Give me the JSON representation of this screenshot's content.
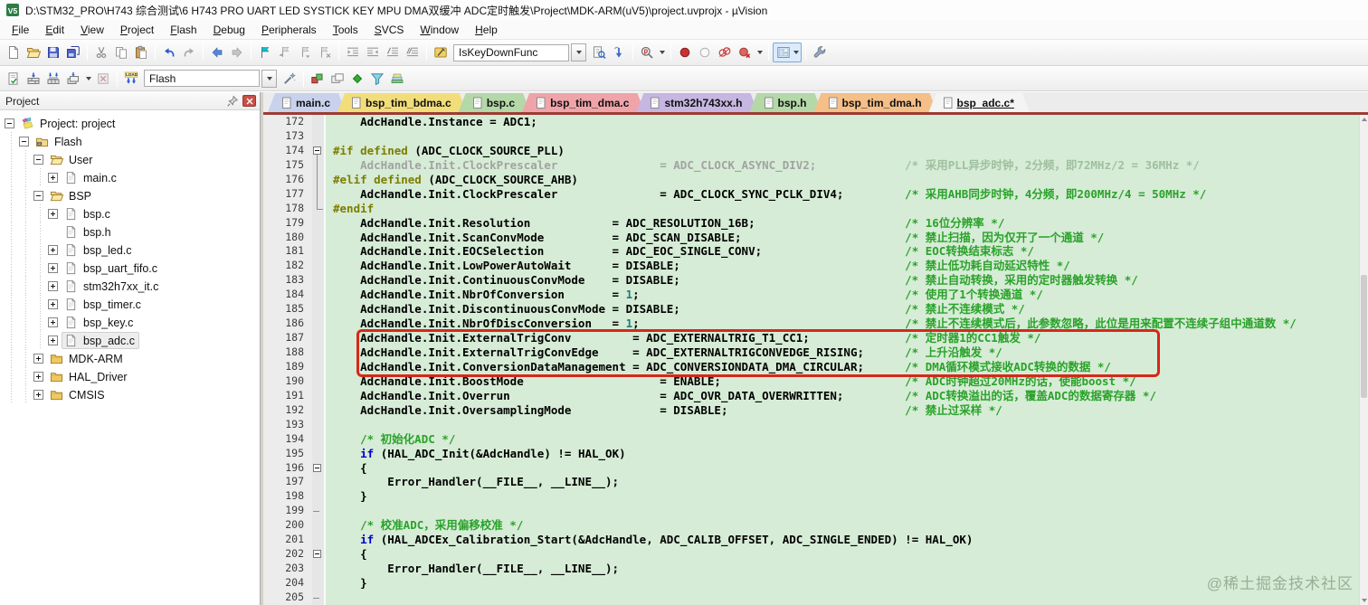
{
  "window": {
    "title": "D:\\STM32_PRO\\H743 综合测试\\6 H743 PRO UART LED SYSTICK KEY MPU DMA双缓冲 ADC定时触发\\Project\\MDK-ARM(uV5)\\project.uvprojx - µVision",
    "app_icon": "uvision-logo-icon"
  },
  "menu": [
    "File",
    "Edit",
    "View",
    "Project",
    "Flash",
    "Debug",
    "Peripherals",
    "Tools",
    "SVCS",
    "Window",
    "Help"
  ],
  "toolbar_main": {
    "function_combo": {
      "value": "IsKeyDownFunc"
    },
    "items": [
      {
        "icon": "new-file"
      },
      {
        "icon": "open-folder"
      },
      {
        "icon": "save"
      },
      {
        "icon": "save-all"
      },
      {
        "sep": true
      },
      {
        "icon": "cut"
      },
      {
        "icon": "copy"
      },
      {
        "icon": "paste"
      },
      {
        "sep": true
      },
      {
        "icon": "undo"
      },
      {
        "icon": "redo"
      },
      {
        "sep": true
      },
      {
        "icon": "nav-back"
      },
      {
        "icon": "nav-forward"
      },
      {
        "sep": true
      },
      {
        "icon": "bookmark-toggle"
      },
      {
        "icon": "bookmark-prev"
      },
      {
        "icon": "bookmark-next"
      },
      {
        "icon": "bookmark-clear"
      },
      {
        "sep": true
      },
      {
        "icon": "indent"
      },
      {
        "icon": "unindent"
      },
      {
        "icon": "comment"
      },
      {
        "icon": "uncomment"
      },
      {
        "sep": true
      },
      {
        "icon": "functions"
      },
      {
        "combo": "toolbar_main.function_combo.value",
        "name": "function-select"
      },
      {
        "icon": "find-in-files"
      },
      {
        "icon": "goto-definition"
      },
      {
        "sep": true
      },
      {
        "icon": "search"
      },
      {
        "caret": true
      },
      {
        "sep": true
      },
      {
        "icon": "breakpoint"
      },
      {
        "icon": "breakpoint-enable"
      },
      {
        "icon": "breakpoint-disable-all"
      },
      {
        "icon": "breakpoint-kill-all"
      },
      {
        "caret": true
      },
      {
        "sep": true
      },
      {
        "icon": "window-layout",
        "state": "active",
        "caret_in": true
      },
      {
        "sep": true
      },
      {
        "icon": "configure"
      }
    ]
  },
  "toolbar_build": {
    "target_combo": {
      "value": "Flash"
    },
    "items": [
      {
        "icon": "translate"
      },
      {
        "icon": "build"
      },
      {
        "icon": "rebuild"
      },
      {
        "icon": "batch-build"
      },
      {
        "caret": true
      },
      {
        "icon": "stop-build"
      },
      {
        "sep": true
      },
      {
        "icon": "load"
      },
      {
        "combo": "toolbar_build.target_combo.value",
        "name": "target-select"
      },
      {
        "icon": "options-wand"
      },
      {
        "sep": true
      },
      {
        "icon": "manage-components"
      },
      {
        "icon": "window-stack"
      },
      {
        "icon": "project-diamond"
      },
      {
        "icon": "filter-funnel"
      },
      {
        "icon": "books-stack"
      }
    ]
  },
  "project_panel": {
    "title": "Project",
    "tree": [
      {
        "label": "Project: project",
        "level": 0,
        "expander": "minus",
        "icon": "project"
      },
      {
        "label": "Flash",
        "level": 1,
        "expander": "minus",
        "icon": "target-folder"
      },
      {
        "label": "User",
        "level": 2,
        "expander": "minus",
        "icon": "folder-open"
      },
      {
        "label": "main.c",
        "level": 3,
        "expander": "plus",
        "icon": "file"
      },
      {
        "label": "BSP",
        "level": 2,
        "expander": "minus",
        "icon": "folder-open"
      },
      {
        "label": "bsp.c",
        "level": 3,
        "expander": "plus",
        "icon": "file"
      },
      {
        "label": "bsp.h",
        "level": 3,
        "expander": "none",
        "icon": "file"
      },
      {
        "label": "bsp_led.c",
        "level": 3,
        "expander": "plus",
        "icon": "file"
      },
      {
        "label": "bsp_uart_fifo.c",
        "level": 3,
        "expander": "plus",
        "icon": "file"
      },
      {
        "label": "stm32h7xx_it.c",
        "level": 3,
        "expander": "plus",
        "icon": "file"
      },
      {
        "label": "bsp_timer.c",
        "level": 3,
        "expander": "plus",
        "icon": "file"
      },
      {
        "label": "bsp_key.c",
        "level": 3,
        "expander": "plus",
        "icon": "file"
      },
      {
        "label": "bsp_adc.c",
        "level": 3,
        "expander": "plus",
        "icon": "file",
        "selected": true
      },
      {
        "label": "MDK-ARM",
        "level": 2,
        "expander": "plus",
        "icon": "folder-closed"
      },
      {
        "label": "HAL_Driver",
        "level": 2,
        "expander": "plus",
        "icon": "folder-closed"
      },
      {
        "label": "CMSIS",
        "level": 2,
        "expander": "plus",
        "icon": "folder-closed"
      }
    ]
  },
  "tabs": [
    {
      "label": "main.c",
      "color": "#c8d2ec"
    },
    {
      "label": "bsp_tim_bdma.c",
      "color": "#f2dd7b"
    },
    {
      "label": "bsp.c",
      "color": "#b4d8a8"
    },
    {
      "label": "bsp_tim_dma.c",
      "color": "#efa4a9"
    },
    {
      "label": "stm32h743xx.h",
      "color": "#c6b6e2"
    },
    {
      "label": "bsp.h",
      "color": "#b4d8a8"
    },
    {
      "label": "bsp_tim_dma.h",
      "color": "#f4bf88"
    },
    {
      "label": "bsp_adc.c*",
      "color": "#f4f4f4",
      "active": true
    }
  ],
  "editor": {
    "first_line": 172,
    "annotation": {
      "from_line": 187,
      "to_line": 189
    },
    "lines": [
      {
        "n": 172,
        "f": "",
        "s": [
          [
            "t",
            "    AdcHandle.Instance = ADC1;"
          ]
        ]
      },
      {
        "n": 173,
        "f": "",
        "s": []
      },
      {
        "n": 174,
        "f": "boxline",
        "s": [
          [
            "p",
            "#if defined "
          ],
          [
            "t",
            "(ADC_CLOCK_SOURCE_PLL)"
          ]
        ]
      },
      {
        "n": 175,
        "f": "line",
        "s": [
          [
            "g",
            "    AdcHandle.Init.ClockPrescaler               = ADC_CLOCK_ASYNC_DIV2;"
          ],
          [
            "gc",
            "             /* 采用PLL异步时钟，2分频，即72MHz/2 = 36MHz */"
          ]
        ]
      },
      {
        "n": 176,
        "f": "line",
        "s": [
          [
            "p",
            "#elif defined "
          ],
          [
            "t",
            "(ADC_CLOCK_SOURCE_AHB)"
          ]
        ]
      },
      {
        "n": 177,
        "f": "line",
        "s": [
          [
            "t",
            "    AdcHandle.Init.ClockPrescaler               = ADC_CLOCK_SYNC_PCLK_DIV4;"
          ],
          [
            "c",
            "         /* 采用AHB同步时钟，4分频，即200MHz/4 = 50MHz */"
          ]
        ]
      },
      {
        "n": 178,
        "f": "end",
        "s": [
          [
            "p",
            "#endif"
          ]
        ]
      },
      {
        "n": 179,
        "f": "",
        "s": [
          [
            "t",
            "    AdcHandle.Init.Resolution            = ADC_RESOLUTION_16B;"
          ],
          [
            "c",
            "                      /* 16位分辨率 */"
          ]
        ]
      },
      {
        "n": 180,
        "f": "",
        "s": [
          [
            "t",
            "    AdcHandle.Init.ScanConvMode          = ADC_SCAN_DISABLE;"
          ],
          [
            "c",
            "                        /* 禁止扫描，因为仅开了一个通道 */"
          ]
        ]
      },
      {
        "n": 181,
        "f": "",
        "s": [
          [
            "t",
            "    AdcHandle.Init.EOCSelection          = ADC_EOC_SINGLE_CONV;"
          ],
          [
            "c",
            "                     /* EOC转换结束标志 */"
          ]
        ]
      },
      {
        "n": 182,
        "f": "",
        "s": [
          [
            "t",
            "    AdcHandle.Init.LowPowerAutoWait      = DISABLE;"
          ],
          [
            "c",
            "                                 /* 禁止低功耗自动延迟特性 */"
          ]
        ]
      },
      {
        "n": 183,
        "f": "",
        "s": [
          [
            "t",
            "    AdcHandle.Init.ContinuousConvMode    = DISABLE;"
          ],
          [
            "c",
            "                                 /* 禁止自动转换，采用的定时器触发转换 */"
          ]
        ]
      },
      {
        "n": 184,
        "f": "",
        "s": [
          [
            "t",
            "    AdcHandle.Init.NbrOfConversion       = "
          ],
          [
            "n",
            "1"
          ],
          [
            "t",
            ";"
          ],
          [
            "c",
            "                                       /* 使用了1个转换通道 */"
          ]
        ]
      },
      {
        "n": 185,
        "f": "",
        "s": [
          [
            "t",
            "    AdcHandle.Init.DiscontinuousConvMode = DISABLE;"
          ],
          [
            "c",
            "                                 /* 禁止不连续模式 */"
          ]
        ]
      },
      {
        "n": 186,
        "f": "",
        "s": [
          [
            "t",
            "    AdcHandle.Init.NbrOfDiscConversion   = "
          ],
          [
            "n",
            "1"
          ],
          [
            "t",
            ";"
          ],
          [
            "c",
            "                                       /* 禁止不连续模式后，此参数忽略，此位是用来配置不连续子组中通道数 */"
          ]
        ]
      },
      {
        "n": 187,
        "f": "",
        "s": [
          [
            "t",
            "    AdcHandle.Init.ExternalTrigConv         = ADC_EXTERNALTRIG_T1_CC1;"
          ],
          [
            "c",
            "              /* 定时器1的CC1触发 */"
          ]
        ]
      },
      {
        "n": 188,
        "f": "",
        "s": [
          [
            "t",
            "    AdcHandle.Init.ExternalTrigConvEdge     = ADC_EXTERNALTRIGCONVEDGE_RISING;"
          ],
          [
            "c",
            "      /* 上升沿触发 */"
          ]
        ]
      },
      {
        "n": 189,
        "f": "",
        "s": [
          [
            "t",
            "    AdcHandle.Init.ConversionDataManagement = ADC_CONVERSIONDATA_DMA_CIRCULAR;"
          ],
          [
            "c",
            "      /* DMA循环模式接收ADC转换的数据 */"
          ]
        ]
      },
      {
        "n": 190,
        "f": "",
        "s": [
          [
            "t",
            "    AdcHandle.Init.BoostMode                    = ENABLE;"
          ],
          [
            "c",
            "                           /* ADC时钟超过20MHz的话，使能boost */"
          ]
        ]
      },
      {
        "n": 191,
        "f": "",
        "s": [
          [
            "t",
            "    AdcHandle.Init.Overrun                      = ADC_OVR_DATA_OVERWRITTEN;"
          ],
          [
            "c",
            "         /* ADC转换溢出的话，覆盖ADC的数据寄存器 */"
          ]
        ]
      },
      {
        "n": 192,
        "f": "",
        "s": [
          [
            "t",
            "    AdcHandle.Init.OversamplingMode             = DISABLE;"
          ],
          [
            "c",
            "                          /* 禁止过采样 */"
          ]
        ]
      },
      {
        "n": 193,
        "f": "",
        "s": []
      },
      {
        "n": 194,
        "f": "",
        "s": [
          [
            "t",
            "    "
          ],
          [
            "c",
            "/* 初始化ADC */"
          ]
        ]
      },
      {
        "n": 195,
        "f": "",
        "s": [
          [
            "t",
            "    "
          ],
          [
            "k",
            "if"
          ],
          [
            "t",
            " (HAL_ADC_Init(&AdcHandle) != HAL_OK)"
          ]
        ]
      },
      {
        "n": 196,
        "f": "box",
        "s": [
          [
            "t",
            "    {"
          ]
        ]
      },
      {
        "n": 197,
        "f": "",
        "s": [
          [
            "t",
            "        Error_Handler(__FILE__, __LINE__);"
          ]
        ]
      },
      {
        "n": 198,
        "f": "",
        "s": [
          [
            "t",
            "    }"
          ]
        ]
      },
      {
        "n": 199,
        "f": "tick",
        "s": []
      },
      {
        "n": 200,
        "f": "",
        "s": [
          [
            "t",
            "    "
          ],
          [
            "c",
            "/* 校准ADC，采用偏移校准 */"
          ]
        ]
      },
      {
        "n": 201,
        "f": "",
        "s": [
          [
            "t",
            "    "
          ],
          [
            "k",
            "if"
          ],
          [
            "t",
            " (HAL_ADCEx_Calibration_Start(&AdcHandle, ADC_CALIB_OFFSET, ADC_SINGLE_ENDED) != HAL_OK)"
          ]
        ]
      },
      {
        "n": 202,
        "f": "box",
        "s": [
          [
            "t",
            "    {"
          ]
        ]
      },
      {
        "n": 203,
        "f": "",
        "s": [
          [
            "t",
            "        Error_Handler(__FILE__, __LINE__);"
          ]
        ]
      },
      {
        "n": 204,
        "f": "",
        "s": [
          [
            "t",
            "    }"
          ]
        ]
      },
      {
        "n": 205,
        "f": "tick",
        "s": []
      }
    ]
  },
  "watermark": "@稀土掘金技术社区",
  "colors": {
    "editor_bg": "#d6ecd6",
    "comment": "#2aa22a",
    "inactive_comment": "#9fbf9f",
    "keyword": "#0000d0",
    "preprocessor": "#7d7d00",
    "inactive": "#a2a2a2",
    "number": "#1f7d7d",
    "annotation_red": "#d6281a",
    "tab_strip": "#9c3b33"
  }
}
